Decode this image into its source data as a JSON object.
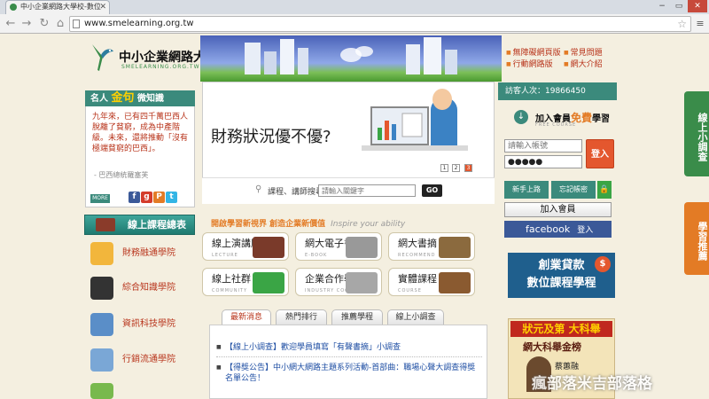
{
  "browser": {
    "tab_title": "中小企業網路大學校-數位",
    "url": "www.smelearning.org.tw",
    "win_min": "−",
    "win_max": "▭",
    "win_close": "✕"
  },
  "header": {
    "logo_text": "中小企業網路大學校",
    "logo_sub": "SMELEARNING.ORG.TW",
    "top_links": [
      "無障礙網頁版",
      "常見問題",
      "行動網路版",
      "網大介紹"
    ]
  },
  "famous": {
    "title_a": "名人",
    "title_b": "金句",
    "title_c": "微知識",
    "quote": "九年來，已有四千萬巴西人脫離了貧窮，成為中產階級。未來，還將推動「沒有極端貧窮的巴西」。",
    "author": "- 巴西總統羅塞芙",
    "more": "MORE"
  },
  "left_nav": {
    "course_total": "線上課程總表",
    "colleges": [
      "財務融通學院",
      "綜合知識學院",
      "資訊科技學院",
      "行銷流通學院"
    ]
  },
  "banner": {
    "title": "財務狀況優不優?",
    "dots": [
      "1",
      "2",
      "3"
    ],
    "search_label": "課程、講師搜尋",
    "search_placeholder": "請輸入關鍵字",
    "go": "GO"
  },
  "slogan": {
    "text": "開啟學習新視界 創造企業新價值",
    "en": "Inspire your ability"
  },
  "services": [
    {
      "label": "線上演講廳",
      "sub": "LECTURE"
    },
    {
      "label": "網大電子書",
      "sub": "E-BOOK"
    },
    {
      "label": "網大書摘",
      "sub": "RECOMMEND"
    },
    {
      "label": "線上社群",
      "sub": "COMMUNITY"
    },
    {
      "label": "企業合作學程",
      "sub": "INDUSTRY COOPERATION"
    },
    {
      "label": "實體課程",
      "sub": "COURSE"
    }
  ],
  "news": {
    "tabs": [
      "最新消息",
      "熱門排行",
      "推薦學程",
      "線上小調查"
    ],
    "items": [
      "【線上小調查】歡迎學員填寫「有聲書摘」小調查",
      "【得獎公告】中小網大網路主題系列活動-首部曲：職場心聲大調查得獎名單公告！"
    ]
  },
  "right": {
    "visitor": "訪客人次：19866450",
    "join_a": "加入會員",
    "join_b": "免費",
    "join_c": "學習",
    "join_sub": "FREE COURSE",
    "account_placeholder": "請輸入帳號",
    "password_value": "●●●●●",
    "login": "登入",
    "newbie": "新手上路",
    "forgot": "忘記帳密",
    "add_member": "加入會員",
    "facebook": "facebook",
    "facebook_login": "登入",
    "loan_line1": "創業貸款",
    "loan_line2": "數位課程學程",
    "exam_title": "狀元及第 大科舉",
    "exam_sub": "網大科舉金榜",
    "exam_name": "蔡蕙融"
  },
  "side_tabs": [
    "線上小調查",
    "學習推薦"
  ],
  "watermark": "瘋部落米吉部落格"
}
